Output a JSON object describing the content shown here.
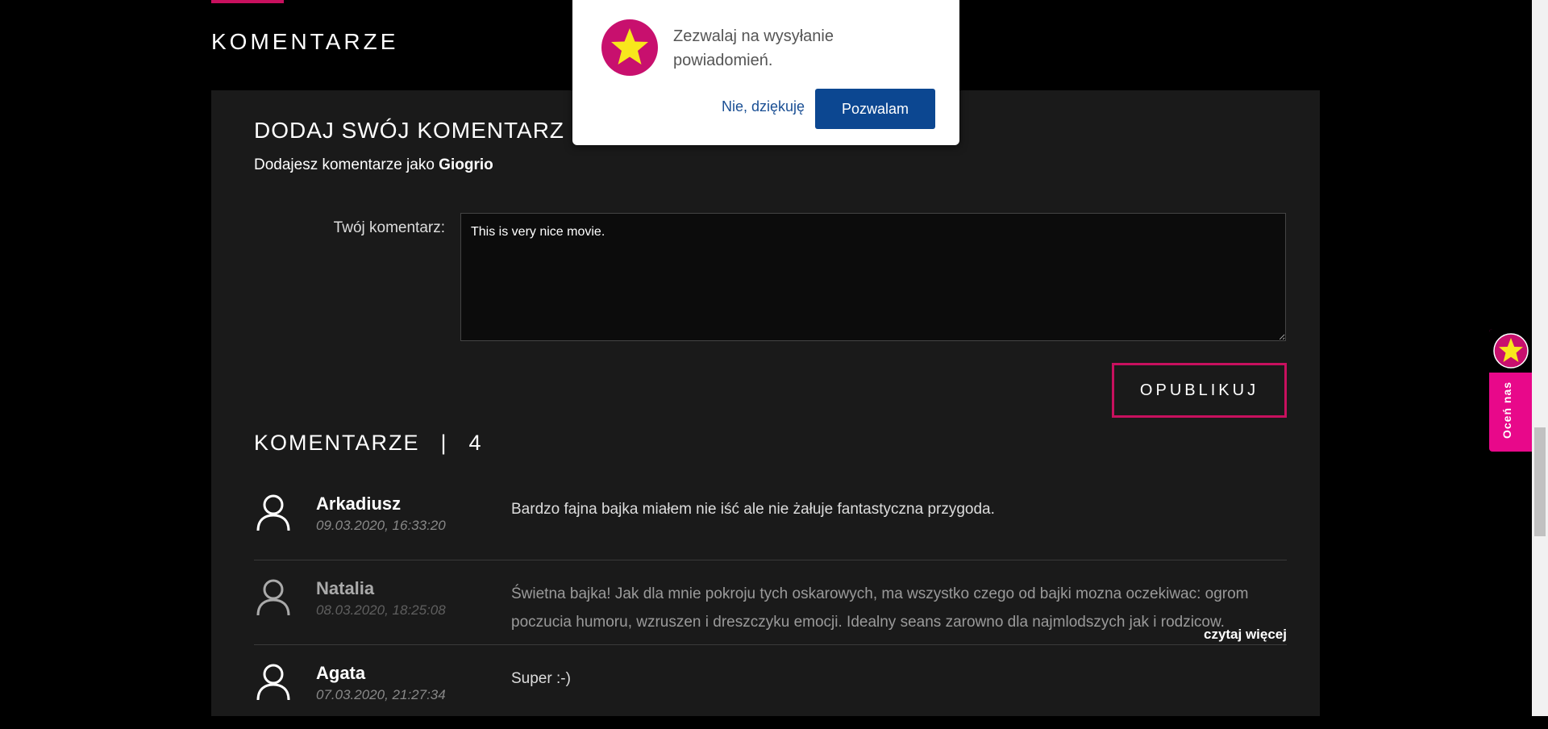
{
  "section": {
    "heading": "KOMENTARZE"
  },
  "form": {
    "title": "DODAJ SWÓJ KOMENTARZ DO NA",
    "as_user_prefix": "Dodajesz komentarze jako",
    "username": "Giogrio",
    "comment_label": "Twój komentarz:",
    "comment_value": "This is very nice movie.",
    "publish_label": "OPUBLIKUJ"
  },
  "comments": {
    "heading": "KOMENTARZE",
    "separator": "|",
    "count": "4",
    "read_more": "czytaj więcej",
    "items": [
      {
        "author": "Arkadiusz",
        "date": "09.03.2020, 16:33:20",
        "text": "Bardzo fajna bajka miałem nie iść ale nie żałuje fantastyczna przygoda."
      },
      {
        "author": "Natalia",
        "date": "08.03.2020, 18:25:08",
        "text": "Świetna bajka! Jak dla mnie pokroju tych oskarowych, ma wszystko czego od bajki mozna oczekiwac: ogrom poczucia humoru, wzruszen i dreszczyku emocji. Idealny seans zarowno dla najmlodszych jak i rodzicow."
      },
      {
        "author": "Agata",
        "date": "07.03.2020, 21:27:34",
        "text": "Super :-)"
      }
    ]
  },
  "popup": {
    "message": "Zezwalaj na wysyłanie powiadomień.",
    "deny_label": "Nie, dziękuję",
    "allow_label": "Pozwalam"
  },
  "rate_tab": {
    "label": "Oceń nas",
    "icon": "star-logo-icon"
  },
  "colors": {
    "accent": "#c8105e",
    "rate_tab": "#e8088a",
    "allow_button": "#0c4791",
    "panel": "#1a1a1a"
  }
}
